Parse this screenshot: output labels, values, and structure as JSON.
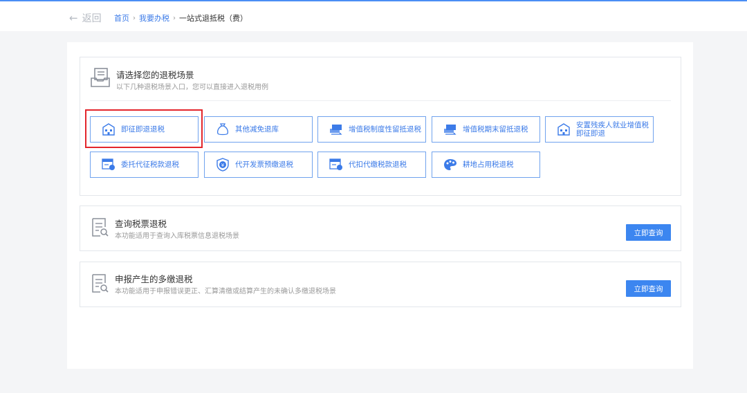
{
  "header": {
    "back_label": "返回",
    "breadcrumb": [
      "首页",
      "我要办税",
      "一站式退抵税（费）"
    ]
  },
  "scene_panel": {
    "title": "请选择您的退税场景",
    "subtitle": "以下几种退税场景入口，您可以直接进入退税用例",
    "cards": [
      {
        "label": "即征即退退税",
        "icon": "building-icon"
      },
      {
        "label": "其他减免退库",
        "icon": "money-bag-icon"
      },
      {
        "label": "增值税制度性留抵退税",
        "icon": "exchange-icon"
      },
      {
        "label": "增值税期末留抵退税",
        "icon": "exchange-icon"
      },
      {
        "label": "安置残疾人就业增值税即征即退",
        "icon": "building-icon"
      },
      {
        "label": "委托代征税款退税",
        "icon": "document-person-icon"
      },
      {
        "label": "代开发票预缴退税",
        "icon": "shield-yen-icon"
      },
      {
        "label": "代扣代缴税款退税",
        "icon": "document-person-icon"
      },
      {
        "label": "耕地占用税退税",
        "icon": "palette-icon"
      }
    ]
  },
  "query_panel": {
    "title": "查询税票退税",
    "subtitle": "本功能适用于查询入库税票信息退税场景",
    "button": "立即查询"
  },
  "overpay_panel": {
    "title": "申报产生的多缴退税",
    "subtitle": "本功能适用于申报错误更正、汇算清缴或结算产生的未确认多缴退税场景",
    "button": "立即查询"
  },
  "colors": {
    "accent": "#3c7be8",
    "highlight": "#e3252b",
    "button": "#3c86f0"
  }
}
